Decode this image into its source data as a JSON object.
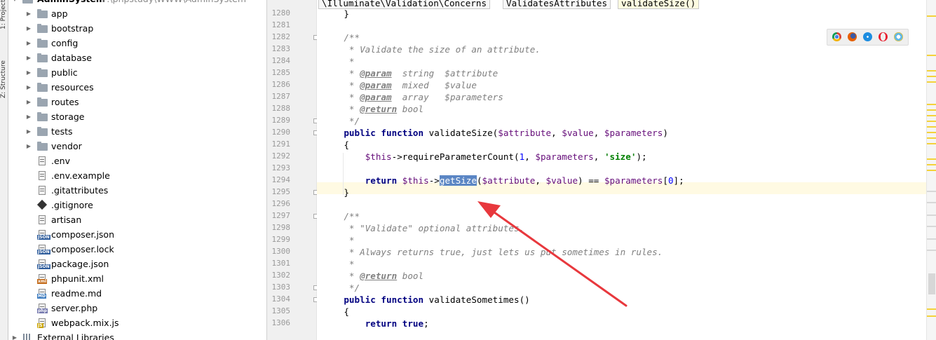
{
  "project_tree": {
    "root": {
      "name": "AdminSystem",
      "path": "F:\\phpstudy\\WWW\\AdminSystem"
    },
    "folders": [
      "app",
      "bootstrap",
      "config",
      "database",
      "public",
      "resources",
      "routes",
      "storage",
      "tests",
      "vendor"
    ],
    "files": [
      {
        "name": ".env",
        "icon": "text-file-icon"
      },
      {
        "name": ".env.example",
        "icon": "text-file-icon"
      },
      {
        "name": ".gitattributes",
        "icon": "text-file-icon"
      },
      {
        "name": ".gitignore",
        "icon": "git-file-icon"
      },
      {
        "name": "artisan",
        "icon": "text-file-icon"
      },
      {
        "name": "composer.json",
        "icon": "json-file-icon",
        "tag": "JSON"
      },
      {
        "name": "composer.lock",
        "icon": "json-file-icon",
        "tag": "JSON"
      },
      {
        "name": "package.json",
        "icon": "json-file-icon",
        "tag": "JSON"
      },
      {
        "name": "phpunit.xml",
        "icon": "xml-file-icon",
        "tag": "xml"
      },
      {
        "name": "readme.md",
        "icon": "markdown-file-icon",
        "tag": "MD"
      },
      {
        "name": "server.php",
        "icon": "php-file-icon",
        "tag": "php"
      },
      {
        "name": "webpack.mix.js",
        "icon": "js-file-icon",
        "tag": "JS"
      }
    ],
    "external_libraries": "External Libraries"
  },
  "tool_stripe": {
    "project_label": "1: Project",
    "structure_label": "Z: Structure"
  },
  "breadcrumb": [
    "\\Illuminate\\Validation\\Concerns",
    "ValidatesAttributes",
    "validateSize()"
  ],
  "browsers": [
    "chrome-icon",
    "firefox-icon",
    "safari-icon",
    "opera-icon",
    "ie-icon"
  ],
  "colors": {
    "selection": "#5b86c4",
    "caret_line": "#fffae3",
    "keyword": "#000080",
    "variable": "#660e7a",
    "string": "#008000",
    "annotation_arrow": "#e8383d"
  },
  "editor": {
    "caret_line_number": "1294",
    "selected_word": "getSize",
    "lines": [
      {
        "n": "1280",
        "tokens": [
          [
            "p",
            "}"
          ]
        ]
      },
      {
        "n": "1281",
        "tokens": []
      },
      {
        "n": "1282",
        "tokens": [
          [
            "c",
            "/**"
          ]
        ]
      },
      {
        "n": "1283",
        "tokens": [
          [
            "c",
            " * Validate the size of an attribute."
          ]
        ]
      },
      {
        "n": "1284",
        "tokens": [
          [
            "c",
            " *"
          ]
        ]
      },
      {
        "n": "1285",
        "tokens": [
          [
            "c",
            " * "
          ],
          [
            "d",
            "@param"
          ],
          [
            "c",
            "  string  $attribute"
          ]
        ]
      },
      {
        "n": "1286",
        "tokens": [
          [
            "c",
            " * "
          ],
          [
            "d",
            "@param"
          ],
          [
            "c",
            "  mixed   $value"
          ]
        ]
      },
      {
        "n": "1287",
        "tokens": [
          [
            "c",
            " * "
          ],
          [
            "d",
            "@param"
          ],
          [
            "c",
            "  array   $parameters"
          ]
        ]
      },
      {
        "n": "1288",
        "tokens": [
          [
            "c",
            " * "
          ],
          [
            "d",
            "@return"
          ],
          [
            "c",
            " bool"
          ]
        ]
      },
      {
        "n": "1289",
        "tokens": [
          [
            "c",
            " */"
          ]
        ]
      },
      {
        "n": "1290",
        "tokens": [
          [
            "k",
            "public function "
          ],
          [
            "p",
            "validateSize("
          ],
          [
            "v",
            "$attribute"
          ],
          [
            "p",
            ", "
          ],
          [
            "v",
            "$value"
          ],
          [
            "p",
            ", "
          ],
          [
            "v",
            "$parameters"
          ],
          [
            "p",
            ")"
          ]
        ]
      },
      {
        "n": "1291",
        "tokens": [
          [
            "p",
            "{"
          ]
        ]
      },
      {
        "n": "1292",
        "tokens": [
          [
            "p",
            "    "
          ],
          [
            "v",
            "$this"
          ],
          [
            "p",
            "->requireParameterCount("
          ],
          [
            "n",
            "1"
          ],
          [
            "p",
            ", "
          ],
          [
            "v",
            "$parameters"
          ],
          [
            "p",
            ", "
          ],
          [
            "s",
            "'size'"
          ],
          [
            "p",
            ");"
          ]
        ]
      },
      {
        "n": "1293",
        "tokens": []
      },
      {
        "n": "1294",
        "tokens": [
          [
            "p",
            "    "
          ],
          [
            "k",
            "return "
          ],
          [
            "v",
            "$this"
          ],
          [
            "p",
            "->"
          ],
          [
            "h",
            "getSize"
          ],
          [
            "p",
            "("
          ],
          [
            "v",
            "$attribute"
          ],
          [
            "p",
            ", "
          ],
          [
            "v",
            "$value"
          ],
          [
            "p",
            ") == "
          ],
          [
            "v",
            "$parameters"
          ],
          [
            "p",
            "["
          ],
          [
            "n",
            "0"
          ],
          [
            "p",
            "];"
          ]
        ]
      },
      {
        "n": "1295",
        "tokens": [
          [
            "p",
            "}"
          ]
        ]
      },
      {
        "n": "1296",
        "tokens": []
      },
      {
        "n": "1297",
        "tokens": [
          [
            "c",
            "/**"
          ]
        ]
      },
      {
        "n": "1298",
        "tokens": [
          [
            "c",
            " * \"Validate\" optional attributes."
          ]
        ]
      },
      {
        "n": "1299",
        "tokens": [
          [
            "c",
            " *"
          ]
        ]
      },
      {
        "n": "1300",
        "tokens": [
          [
            "c",
            " * Always returns true, just lets us put sometimes in rules."
          ]
        ]
      },
      {
        "n": "1301",
        "tokens": [
          [
            "c",
            " *"
          ]
        ]
      },
      {
        "n": "1302",
        "tokens": [
          [
            "c",
            " * "
          ],
          [
            "d",
            "@return"
          ],
          [
            "c",
            " bool"
          ]
        ]
      },
      {
        "n": "1303",
        "tokens": [
          [
            "c",
            " */"
          ]
        ]
      },
      {
        "n": "1304",
        "tokens": [
          [
            "k",
            "public function "
          ],
          [
            "p",
            "validateSometimes()"
          ]
        ]
      },
      {
        "n": "1305",
        "tokens": [
          [
            "p",
            "{"
          ]
        ]
      },
      {
        "n": "1306",
        "tokens": [
          [
            "p",
            "    "
          ],
          [
            "k",
            "return true"
          ],
          [
            "p",
            ";"
          ]
        ]
      }
    ]
  }
}
